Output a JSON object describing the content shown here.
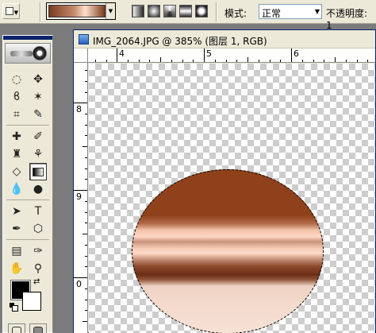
{
  "optionsbar": {
    "mode_label": "模式:",
    "mode_value": "正常",
    "opacity_label": "不透明度: 1"
  },
  "document": {
    "title": "IMG_2064.JPG @ 385% (图层 1, RGB)"
  },
  "rulers": {
    "h_labels": [
      "4",
      "5",
      "6"
    ],
    "v_labels": [
      "8",
      "9",
      "0"
    ]
  },
  "colors": {
    "foreground": "#000000",
    "background": "#ffffff",
    "gradient_dark": "#8f411c",
    "gradient_light": "#ffd8c6"
  }
}
